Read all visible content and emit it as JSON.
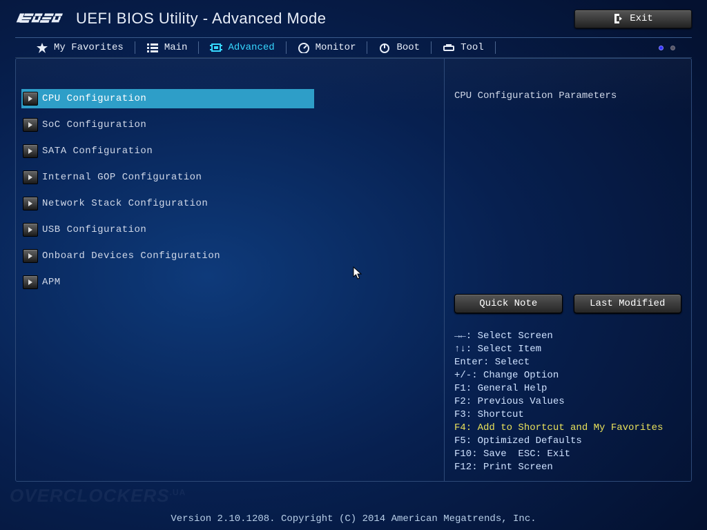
{
  "header": {
    "title": "UEFI BIOS Utility - Advanced Mode",
    "exit_label": "Exit"
  },
  "tabs": [
    {
      "label": "My Favorites",
      "icon": "star"
    },
    {
      "label": "Main",
      "icon": "list"
    },
    {
      "label": "Advanced",
      "icon": "chip",
      "active": true
    },
    {
      "label": "Monitor",
      "icon": "gauge"
    },
    {
      "label": "Boot",
      "icon": "power"
    },
    {
      "label": "Tool",
      "icon": "tool"
    }
  ],
  "menu": [
    {
      "label": "CPU Configuration",
      "selected": true
    },
    {
      "label": "SoC Configuration"
    },
    {
      "label": "SATA Configuration"
    },
    {
      "label": "Internal GOP Configuration"
    },
    {
      "label": "Network Stack Configuration"
    },
    {
      "label": "USB Configuration"
    },
    {
      "label": "Onboard Devices Configuration"
    },
    {
      "label": "APM"
    }
  ],
  "help": {
    "title": "CPU Configuration Parameters",
    "quick_note": "Quick Note",
    "last_modified": "Last Modified",
    "lines": [
      "→←: Select Screen",
      "↑↓: Select Item",
      "Enter: Select",
      "+/-: Change Option",
      "F1: General Help",
      "F2: Previous Values",
      "F3: Shortcut",
      "F4: Add to Shortcut and My Favorites",
      "F5: Optimized Defaults",
      "F10: Save  ESC: Exit",
      "F12: Print Screen"
    ],
    "highlight_index": 7
  },
  "watermark": "OVERCLOCKERS",
  "watermark_suffix": ".UA",
  "footer": "Version 2.10.1208. Copyright (C) 2014 American Megatrends, Inc."
}
